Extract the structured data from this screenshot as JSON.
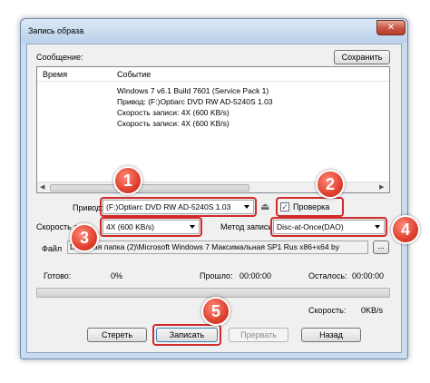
{
  "window": {
    "title": "Запись образа",
    "close_glyph": "✕"
  },
  "message_label": "Сообщение:",
  "save_button": "Сохранить",
  "log": {
    "columns": [
      "Время",
      "Событие"
    ],
    "lines": [
      "Windows 7 v6.1 Build 7601 (Service Pack 1)",
      "Привод: (F:)Optiarc DVD RW AD-5240S 1.03",
      "Скорость записи: 4X (600 KB/s)",
      "Скорость записи: 4X (600 KB/s)"
    ]
  },
  "drive": {
    "label": "Привод:",
    "value": "(F:)Optiarc DVD RW AD-5240S 1.03"
  },
  "verify": {
    "label": "Проверка",
    "checked": true,
    "check_glyph": "✓"
  },
  "speed": {
    "label": "Скорость зап",
    "value": "4X (600 KB/s)"
  },
  "method": {
    "label": "Метод записи",
    "value": "Disc-at-Once(DAO)"
  },
  "file": {
    "label": "Файл",
    "value": "D:\\Новая папка (2)\\Microsoft Windows 7 Максимальная SP1 Rus x86+x64 by",
    "browse_label": "..."
  },
  "stats": {
    "done_label": "Готово:",
    "done_value": "0%",
    "elapsed_label": "Прошло:",
    "elapsed_value": "00:00:00",
    "remaining_label": "Осталось:",
    "remaining_value": "00:00:00",
    "speed_label": "Скорость:",
    "speed_value": "0KB/s"
  },
  "progress_fraction": 0,
  "buttons": {
    "erase": "Стереть",
    "burn": "Записать",
    "abort": "Прервать",
    "back": "Назад"
  },
  "badges": [
    "1",
    "2",
    "3",
    "4",
    "5"
  ],
  "colors": {
    "highlight": "#d02a2a",
    "badge": "#e0402f",
    "window_frame": "#c8dbef"
  }
}
